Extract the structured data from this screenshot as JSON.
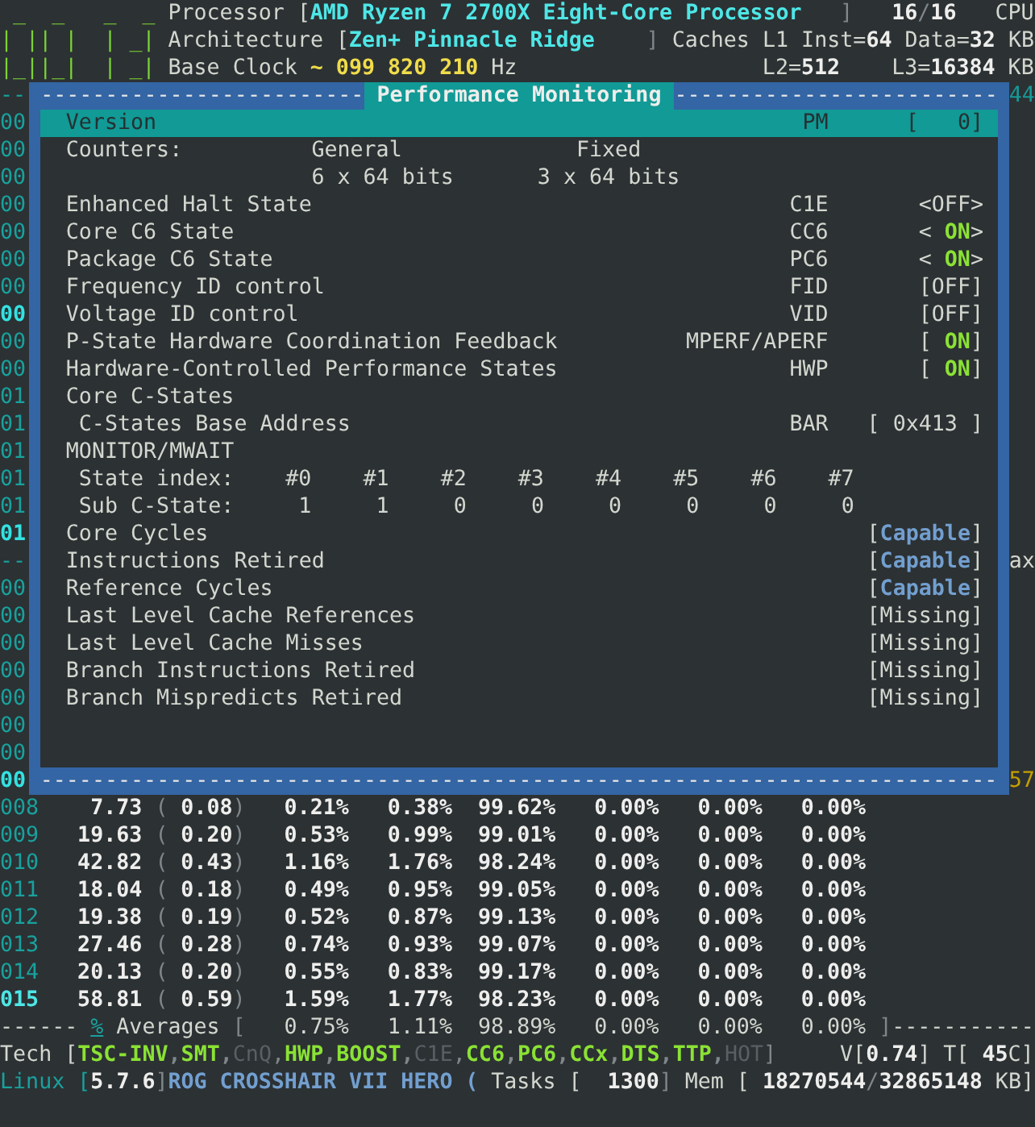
{
  "header": {
    "logo": [
      " _  _   _  _",
      "| || |  | _|",
      "|_||_|  | _|"
    ],
    "processor": {
      "label": "Processor [",
      "value": "AMD Ryzen 7 2700X Eight-Core Processor",
      "close": "]"
    },
    "cpus": {
      "online": "16",
      "separator": "/",
      "total": "16",
      "unit": "CPU"
    },
    "architecture": {
      "label": "Architecture [",
      "value": "Zen+ Pinnacle Ridge",
      "close": "]"
    },
    "caches": {
      "label": "Caches L1 Inst=",
      "inst": "64",
      "data_label": "Data=",
      "data": "32",
      "unit": "KB"
    },
    "base_clock": {
      "label": "Base Clock",
      "value": "~ 099 820 210",
      "unit": "Hz"
    },
    "l2": {
      "label": "L2=",
      "value": "512"
    },
    "l3": {
      "label": "L3=",
      "value": "16384",
      "unit": "KB"
    }
  },
  "dialog": {
    "title": "Performance Monitoring",
    "border": "-",
    "title_edge_left": {
      "text": "--",
      "bright": false
    },
    "title_edge_right": {
      "text": "44",
      "color": "#169a98"
    },
    "rows": [
      {
        "kind": "info",
        "label": "Version",
        "key": "PM",
        "open": "[",
        "value": "0",
        "close": "]",
        "selected": true,
        "edge": {
          "text": "00",
          "bright": false
        }
      },
      {
        "kind": "columns",
        "label": "Counters:",
        "cells": [
          "General",
          "Fixed"
        ],
        "selected": false,
        "edge": {
          "text": "00",
          "bright": false
        }
      },
      {
        "kind": "columns",
        "cells": [
          "6 x 64 bits",
          "3 x 64 bits"
        ],
        "selected": false,
        "edge": {
          "text": "00",
          "bright": false
        }
      },
      {
        "kind": "feature",
        "label": "Enhanced Halt State",
        "key": "C1E",
        "open": "<",
        "value": "OFF",
        "close": ">",
        "enabled": false,
        "selected": false,
        "edge": {
          "text": "00",
          "bright": false
        }
      },
      {
        "kind": "feature",
        "label": "Core C6 State",
        "key": "CC6",
        "open": "<",
        "value": "ON",
        "close": ">",
        "enabled": true,
        "selected": false,
        "edge": {
          "text": "00",
          "bright": false
        }
      },
      {
        "kind": "feature",
        "label": "Package C6 State",
        "key": "PC6",
        "open": "<",
        "value": "ON",
        "close": ">",
        "enabled": true,
        "selected": false,
        "edge": {
          "text": "00",
          "bright": false
        }
      },
      {
        "kind": "feature",
        "label": "Frequency ID control",
        "key": "FID",
        "open": "[",
        "value": "OFF",
        "close": "]",
        "enabled": false,
        "selected": false,
        "edge": {
          "text": "00",
          "bright": false
        }
      },
      {
        "kind": "feature",
        "label": "Voltage ID control",
        "key": "VID",
        "open": "[",
        "value": "OFF",
        "close": "]",
        "enabled": false,
        "selected": false,
        "edge": {
          "text": "00",
          "bright": true
        }
      },
      {
        "kind": "feature",
        "label": "P-State Hardware Coordination Feedback",
        "key": "MPERF/APERF",
        "open": "[",
        "value": "ON",
        "close": "]",
        "enabled": true,
        "selected": false,
        "edge": {
          "text": "00",
          "bright": false
        }
      },
      {
        "kind": "feature",
        "label": "Hardware-Controlled Performance States",
        "key": "HWP",
        "open": "[",
        "value": "ON",
        "close": "]",
        "enabled": true,
        "selected": false,
        "edge": {
          "text": "00",
          "bright": false
        }
      },
      {
        "kind": "section",
        "label": "Core C-States",
        "selected": false,
        "edge": {
          "text": "01",
          "bright": false
        },
        "children": [
          {
            "kind": "address",
            "label": "C-States Base Address",
            "key": "BAR",
            "open": "[",
            "value": "0x413",
            "close": "]",
            "selected": false,
            "edge": {
              "text": "01",
              "bright": false
            }
          }
        ]
      },
      {
        "kind": "section",
        "label": "MONITOR/MWAIT",
        "selected": false,
        "edge": {
          "text": "01",
          "bright": false
        },
        "children": [
          {
            "kind": "index",
            "label": "State index:",
            "cells": [
              "#0",
              "#1",
              "#2",
              "#3",
              "#4",
              "#5",
              "#6",
              "#7"
            ],
            "selected": false,
            "edge": {
              "text": "01",
              "bright": false
            }
          },
          {
            "kind": "index",
            "label": "Sub C-State:",
            "cells": [
              "1",
              "1",
              "0",
              "0",
              "0",
              "0",
              "0",
              "0"
            ],
            "selected": false,
            "edge": {
              "text": "01",
              "bright": false
            }
          }
        ]
      },
      {
        "kind": "capability",
        "label": "Core Cycles",
        "open": "[",
        "value": "Capable",
        "close": "]",
        "capable": true,
        "selected": false,
        "edge": {
          "text": "01",
          "bright": true
        }
      },
      {
        "kind": "capability",
        "label": "Instructions Retired",
        "open": "[",
        "value": "Capable",
        "close": "]",
        "capable": true,
        "selected": false,
        "edge": {
          "text": "--",
          "bright": false
        },
        "right_edge": {
          "text": "ax",
          "color": "#d3d7cf"
        }
      },
      {
        "kind": "capability",
        "label": "Reference Cycles",
        "open": "[",
        "value": "Capable",
        "close": "]",
        "capable": true,
        "selected": false,
        "edge": {
          "text": "00",
          "bright": false
        }
      },
      {
        "kind": "capability",
        "label": "Last Level Cache References",
        "open": "[",
        "value": "Missing",
        "close": "]",
        "capable": false,
        "selected": false,
        "edge": {
          "text": "00",
          "bright": false
        }
      },
      {
        "kind": "capability",
        "label": "Last Level Cache Misses",
        "open": "[",
        "value": "Missing",
        "close": "]",
        "capable": false,
        "selected": false,
        "edge": {
          "text": "00",
          "bright": false
        }
      },
      {
        "kind": "capability",
        "label": "Branch Instructions Retired",
        "open": "[",
        "value": "Missing",
        "close": "]",
        "capable": false,
        "selected": false,
        "edge": {
          "text": "00",
          "bright": false
        }
      },
      {
        "kind": "capability",
        "label": "Branch Mispredicts Retired",
        "open": "[",
        "value": "Missing",
        "close": "]",
        "capable": false,
        "selected": false,
        "edge": {
          "text": "00",
          "bright": false
        }
      },
      {
        "kind": "blank",
        "edge": {
          "text": "00",
          "bright": false
        }
      },
      {
        "kind": "blank",
        "edge": {
          "text": "00",
          "bright": false
        }
      }
    ],
    "bottom_edge_left": {
      "text": "00",
      "bright": true
    },
    "bottom_edge_right": {
      "text": "57",
      "color": "#c4a000"
    }
  },
  "cores": [
    {
      "id": "008",
      "highlight": false,
      "cells": [
        "7.73",
        "(",
        "0.08",
        ")",
        "0.21%",
        "0.38%",
        "99.62%",
        "0.00%",
        "0.00%",
        "0.00%"
      ]
    },
    {
      "id": "009",
      "highlight": false,
      "cells": [
        "19.63",
        "(",
        "0.20",
        ")",
        "0.53%",
        "0.99%",
        "99.01%",
        "0.00%",
        "0.00%",
        "0.00%"
      ]
    },
    {
      "id": "010",
      "highlight": false,
      "cells": [
        "42.82",
        "(",
        "0.43",
        ")",
        "1.16%",
        "1.76%",
        "98.24%",
        "0.00%",
        "0.00%",
        "0.00%"
      ]
    },
    {
      "id": "011",
      "highlight": false,
      "cells": [
        "18.04",
        "(",
        "0.18",
        ")",
        "0.49%",
        "0.95%",
        "99.05%",
        "0.00%",
        "0.00%",
        "0.00%"
      ]
    },
    {
      "id": "012",
      "highlight": false,
      "cells": [
        "19.38",
        "(",
        "0.19",
        ")",
        "0.52%",
        "0.87%",
        "99.13%",
        "0.00%",
        "0.00%",
        "0.00%"
      ]
    },
    {
      "id": "013",
      "highlight": false,
      "cells": [
        "27.46",
        "(",
        "0.28",
        ")",
        "0.74%",
        "0.93%",
        "99.07%",
        "0.00%",
        "0.00%",
        "0.00%"
      ]
    },
    {
      "id": "014",
      "highlight": false,
      "cells": [
        "20.13",
        "(",
        "0.20",
        ")",
        "0.55%",
        "0.83%",
        "99.17%",
        "0.00%",
        "0.00%",
        "0.00%"
      ]
    },
    {
      "id": "015",
      "highlight": true,
      "cells": [
        "58.81",
        "(",
        "0.59",
        ")",
        "1.59%",
        "1.77%",
        "98.23%",
        "0.00%",
        "0.00%",
        "0.00%"
      ]
    }
  ],
  "averages": {
    "lead": "------",
    "marker": "%",
    "label": "Averages",
    "open": "[",
    "values": [
      "0.75%",
      "1.11%",
      "98.89%",
      "0.00%",
      "0.00%",
      "0.00%"
    ],
    "close": "]",
    "trail": "-----------"
  },
  "tech": {
    "label": "Tech [",
    "features": [
      {
        "name": "TSC-INV",
        "enabled": true
      },
      {
        "name": "SMT",
        "enabled": true
      },
      {
        "name": "CnQ",
        "enabled": false
      },
      {
        "name": "HWP",
        "enabled": true
      },
      {
        "name": "BOOST",
        "enabled": true
      },
      {
        "name": "C1E",
        "enabled": false
      },
      {
        "name": "CC6",
        "enabled": true
      },
      {
        "name": "PC6",
        "enabled": true
      },
      {
        "name": "CCx",
        "enabled": true
      },
      {
        "name": "DTS",
        "enabled": true
      },
      {
        "name": "TTP",
        "enabled": true
      },
      {
        "name": "HOT",
        "enabled": false
      }
    ],
    "separator": ",",
    "close": "]"
  },
  "voltage": {
    "label": "V[",
    "value": "0.74",
    "close": "]"
  },
  "temperature": {
    "label": "T[",
    "value": "45",
    "unit": "C]"
  },
  "system": {
    "kernel": {
      "label": "Linux [",
      "version": "5.7.6",
      "close": "]"
    },
    "board": {
      "name": "ROG CROSSHAIR VII HERO",
      "open": "("
    },
    "tasks": {
      "label": "Tasks [",
      "value": "1300",
      "close": "]"
    },
    "memory": {
      "label": "Mem [",
      "used": "18270544",
      "separator": "/",
      "total": "32865148",
      "unit": "KB]"
    }
  }
}
